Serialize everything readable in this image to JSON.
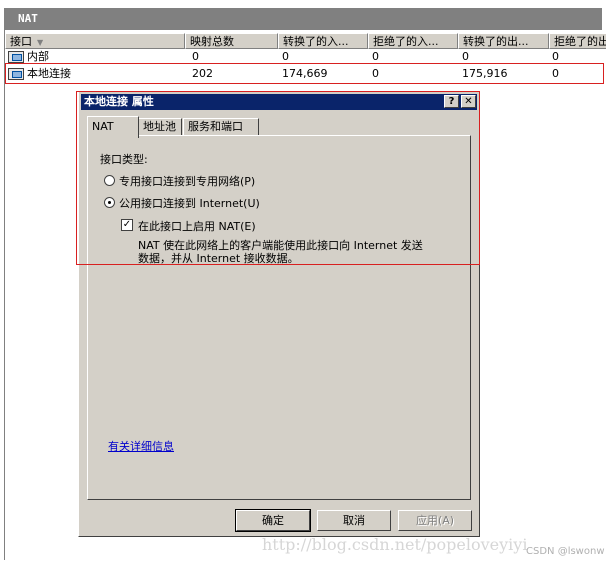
{
  "window": {
    "title": "NAT"
  },
  "listview": {
    "columns": [
      "接口",
      "映射总数",
      "转换了的入...",
      "拒绝了的入...",
      "转换了的出...",
      "拒绝了的出"
    ],
    "rows": [
      {
        "name": "内部",
        "mappings": "0",
        "in_translated": "0",
        "in_rejected": "0",
        "out_translated": "0",
        "out_rejected": "0"
      },
      {
        "name": "本地连接",
        "mappings": "202",
        "in_translated": "174,669",
        "in_rejected": "0",
        "out_translated": "175,916",
        "out_rejected": "0"
      }
    ]
  },
  "dialog": {
    "title": "本地连接 属性",
    "help_button": "?",
    "close_button": "✕",
    "tabs": [
      "NAT",
      "地址池",
      "服务和端口"
    ],
    "interface_type_label": "接口类型:",
    "radio_private": "专用接口连接到专用网络(P)",
    "radio_public": "公用接口连接到 Internet(U)",
    "selected_radio": "public",
    "checkbox_nat": "在此接口上启用 NAT(E)",
    "checkbox_nat_checked": true,
    "nat_description": [
      "NAT 使在此网络上的客户端能使用此接口向 Internet 发送",
      "数据，并从 Internet 接收数据。"
    ],
    "details_link": "有关详细信息",
    "buttons": {
      "ok": "确定",
      "cancel": "取消",
      "apply": "应用(A)"
    }
  },
  "watermark": "http://blog.csdn.net/popeloveyiyi",
  "csdn_badge": "CSDN @lswonw",
  "colors": {
    "highlight_border": "#d82020",
    "dialog_title_bg": "#0a246a",
    "mmc_title_bg": "#808080",
    "link": "#0000cc"
  }
}
